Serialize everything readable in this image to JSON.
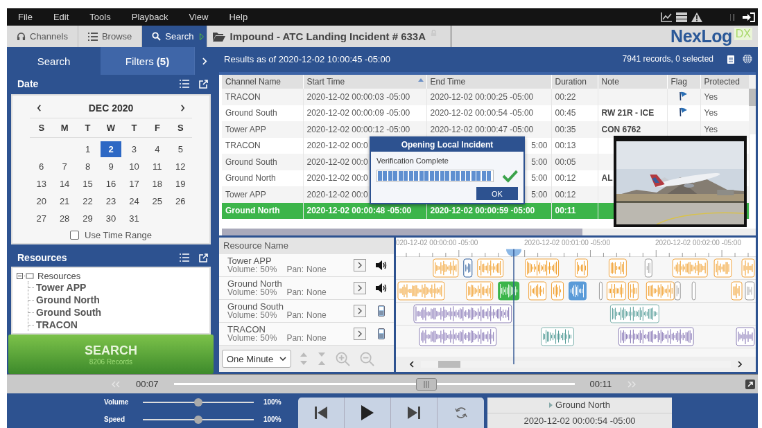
{
  "menu": [
    "File",
    "Edit",
    "Tools",
    "Playback",
    "View",
    "Help"
  ],
  "tabs": [
    {
      "label": "Channels",
      "kind": "headphones",
      "selected": false
    },
    {
      "label": "Browse",
      "kind": "list",
      "selected": false
    },
    {
      "label": "Search",
      "kind": "search",
      "selected": true
    }
  ],
  "incident_tab": {
    "title": "Impound - ATC Landing Incident # 633A",
    "locked": true
  },
  "logo": {
    "name": "NexLog",
    "suffix": "DX"
  },
  "left_tabs": [
    {
      "label": "Search",
      "selected": true
    },
    {
      "label": "Filters **(5)**",
      "selected": false
    }
  ],
  "date_panel": {
    "title": "Date",
    "calendar": {
      "month": "DEC 2020",
      "weekdays": [
        "S",
        "M",
        "T",
        "W",
        "T",
        "F",
        "S"
      ],
      "weeks": [
        [
          {
            "day": "1",
            "selected": false
          },
          {
            "day": "2",
            "selected": true
          },
          {
            "day": "3",
            "selected": false
          },
          {
            "day": "4",
            "selected": false
          },
          {
            "day": "5",
            "selected": false
          }
        ],
        [
          {
            "day": "6",
            "selected": false
          },
          {
            "day": "7",
            "selected": false
          },
          {
            "day": "8",
            "selected": false
          },
          {
            "day": "9",
            "selected": false
          },
          {
            "day": "10",
            "selected": false
          },
          {
            "day": "11",
            "selected": false
          },
          {
            "day": "12",
            "selected": false
          }
        ],
        [
          {
            "day": "13",
            "selected": false
          },
          {
            "day": "14",
            "selected": false
          },
          {
            "day": "15",
            "selected": false
          },
          {
            "day": "16",
            "selected": false
          },
          {
            "day": "17",
            "selected": false
          },
          {
            "day": "18",
            "selected": false
          },
          {
            "day": "19",
            "selected": false
          }
        ],
        [
          {
            "day": "20",
            "selected": false
          },
          {
            "day": "21",
            "selected": false
          },
          {
            "day": "22",
            "selected": false
          },
          {
            "day": "23",
            "selected": false
          },
          {
            "day": "24",
            "selected": false
          },
          {
            "day": "25",
            "selected": false
          },
          {
            "day": "26",
            "selected": false
          }
        ],
        [
          {
            "day": "27",
            "selected": false
          },
          {
            "day": "28",
            "selected": false
          },
          {
            "day": "29",
            "selected": false
          },
          {
            "day": "30",
            "selected": false
          },
          {
            "day": "31",
            "selected": false
          }
        ]
      ]
    },
    "use_time_range": {
      "label": "Use Time Range",
      "checked": false
    }
  },
  "resources_panel": {
    "title": "Resources",
    "tree": [
      {
        "label": "Resources",
        "expanded": true,
        "children": [
          {
            "label": "Tower APP"
          },
          {
            "label": "Ground North"
          },
          {
            "label": "Ground South"
          },
          {
            "label": "TRACON"
          }
        ]
      }
    ]
  },
  "search_button": {
    "label": "SEARCH",
    "count": "8206 Records"
  },
  "results": {
    "title": "Results as of 2020-12-02 10:00:45 -05:00",
    "summary": "7941 records, 0 selected"
  },
  "table": {
    "columns": [
      {
        "label": "Channel Name",
        "sorted": false
      },
      {
        "label": "Start Time",
        "sorted": true
      },
      {
        "label": "End Time",
        "sorted": false
      },
      {
        "label": "Duration",
        "sorted": false
      },
      {
        "label": "Note",
        "sorted": false
      },
      {
        "label": "Flag",
        "sorted": false
      },
      {
        "label": "Protected",
        "sorted": false
      }
    ],
    "rows": [
      {
        "selected": false,
        "channel": "TRACON",
        "start": "2020-12-02 00:00:03 -05:00",
        "end": "2020-12-02 00:00:25 -05:00",
        "end_cut": false,
        "duration": "00:22",
        "flagged": true,
        "protected": "Yes"
      },
      {
        "selected": false,
        "channel": "Ground South",
        "start": "2020-12-02 00:00:09 -05:00",
        "end": "2020-12-02 00:00:54 -05:00",
        "end_cut": false,
        "duration": "00:45",
        "note": "RW 21R - ICE",
        "flagged": true,
        "protected": "Yes"
      },
      {
        "selected": false,
        "channel": "Tower APP",
        "start": "2020-12-02 00:00:12 -05:00",
        "end": "2020-12-02 00:00:47 -05:00",
        "end_cut": false,
        "duration": "00:35",
        "note": "CON 6762",
        "flagged": false,
        "protected": "Yes"
      },
      {
        "selected": false,
        "channel": "TRACON",
        "start": "2020-12-02 00:0",
        "end": "5:00",
        "end_cut": true,
        "duration": "00:13",
        "flagged": false
      },
      {
        "selected": false,
        "channel": "Ground South",
        "start": "2020-12-02 00:0",
        "end": "5:00",
        "end_cut": true,
        "duration": "00:05",
        "flagged": false
      },
      {
        "selected": false,
        "channel": "Ground North",
        "start": "2020-12-02 00:0",
        "end": "5:00",
        "end_cut": true,
        "duration": "00:12",
        "note": "AL",
        "flagged": false
      },
      {
        "selected": false,
        "channel": "Tower APP",
        "start": "2020-12-02 00:0",
        "end": "5:00",
        "end_cut": true,
        "duration": "00:12",
        "flagged": false
      },
      {
        "selected": true,
        "channel": "Ground North",
        "start": "2020-12-02 00:00:48 -05:00",
        "end": "2020-12-02 00:00:59 -05:00",
        "end_cut": false,
        "duration": "00:11",
        "flagged": false
      }
    ]
  },
  "dialog": {
    "title": "Opening Local Incident",
    "message": "Verification Complete",
    "level": 1,
    "complete": true,
    "button": "OK"
  },
  "timeline": {
    "header": "Resource Name",
    "ticks": [
      "020-12-02 00:00:00 -05:00",
      "2020-12-02 00:01:00 -05:00",
      "2020-12-02 00:02:00 -05:00"
    ],
    "resources": [
      {
        "name": "Tower APP",
        "volume_label": "Volume:",
        "volume": "50%",
        "pan_label": "Pan:",
        "pan": "None",
        "kind": "speaker"
      },
      {
        "name": "Ground North",
        "volume_label": "Volume:",
        "volume": "50%",
        "pan_label": "Pan:",
        "pan": "None",
        "kind": "speaker"
      },
      {
        "name": "Ground South",
        "volume_label": "Volume:",
        "volume": "50%",
        "pan_label": "Pan:",
        "pan": "None",
        "kind": "phone"
      },
      {
        "name": "TRACON",
        "volume_label": "Volume:",
        "volume": "50%",
        "pan_label": "Pan:",
        "pan": "None",
        "kind": "phone"
      }
    ],
    "zoom": "One Minute"
  },
  "seek": {
    "start": "00:07",
    "end": "00:11",
    "level": 0.63
  },
  "sliders": [
    {
      "label": "Volume",
      "level": 0.5,
      "reading": "100%"
    },
    {
      "label": "Speed",
      "level": 0.5,
      "reading": "100%"
    }
  ],
  "now_playing": {
    "channel": "Ground North",
    "time": "2020-12-02 00:00:54 -05:00"
  }
}
